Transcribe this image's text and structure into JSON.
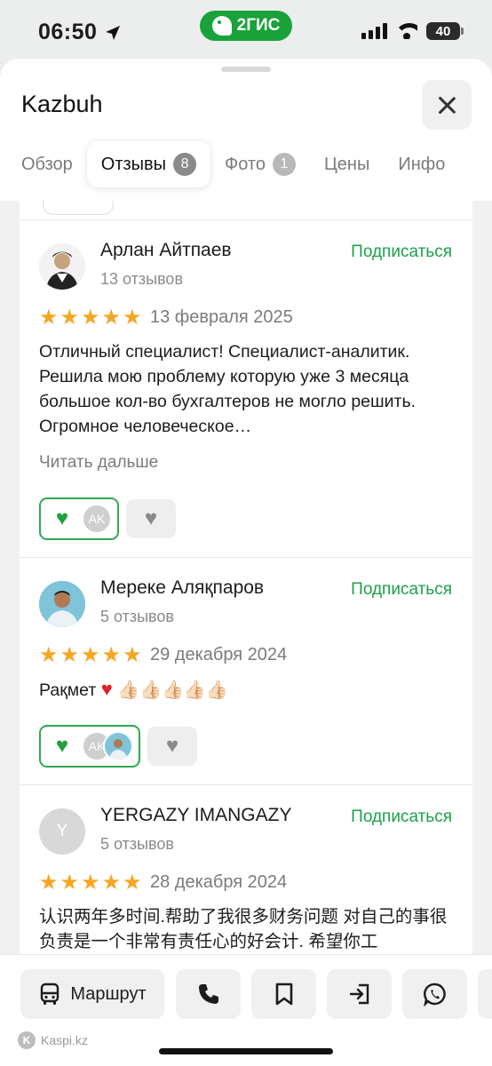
{
  "status": {
    "time": "06:50",
    "app_pill": "2ГИС",
    "battery": "40"
  },
  "sheet": {
    "title": "Kazbuh"
  },
  "tabs": [
    {
      "label": "Обзор"
    },
    {
      "label": "Отзывы",
      "badge": "8"
    },
    {
      "label": "Фото",
      "badge": "1"
    },
    {
      "label": "Цены"
    },
    {
      "label": "Инфо"
    }
  ],
  "reviews": [
    {
      "author": "Арлан Айтпаев",
      "count": "13 отзывов",
      "subscribe": "Подписаться",
      "rating": 5,
      "date": "13 февраля 2025",
      "text": "Отличный специалист! Специалист-аналитик. Решила мою проблему которую уже 3 месяца большое кол-во бухгалтеров не могло решить. Огромное человеческое…",
      "read_more": "Читать дальше",
      "reaction_avatars": [
        "AK"
      ]
    },
    {
      "author": "Мереке Аляқпаров",
      "count": "5 отзывов",
      "subscribe": "Подписаться",
      "rating": 5,
      "date": "29 декабря 2024",
      "text_word": "Рақмет",
      "text_emoji": "👍🏻👍🏻👍🏻👍🏻👍🏻",
      "reaction_avatars": [
        "AK"
      ]
    },
    {
      "author": "YERGAZY IMANGAZY",
      "avatar_letter": "Y",
      "count": "5 отзывов",
      "subscribe": "Подписаться",
      "rating": 5,
      "date": "28 декабря 2024",
      "text": "认识两年多时间.帮助了我很多财务问题 对自己的事很负责是一个非常有责任心的好会计. 希望你工"
    }
  ],
  "toolbar": {
    "route_label": "Маршрут"
  },
  "footer": {
    "watermark": "Kaspi.kz"
  },
  "colors": {
    "accent_green": "#1ba14a",
    "star": "#f5a623",
    "pill_green": "#19a23a"
  },
  "icons": [
    "location-arrow-icon",
    "signal-icon",
    "wifi-icon",
    "battery-icon",
    "close-icon",
    "star-icon",
    "heart-icon",
    "bus-icon",
    "phone-icon",
    "bookmark-icon",
    "share-icon",
    "whatsapp-icon"
  ]
}
